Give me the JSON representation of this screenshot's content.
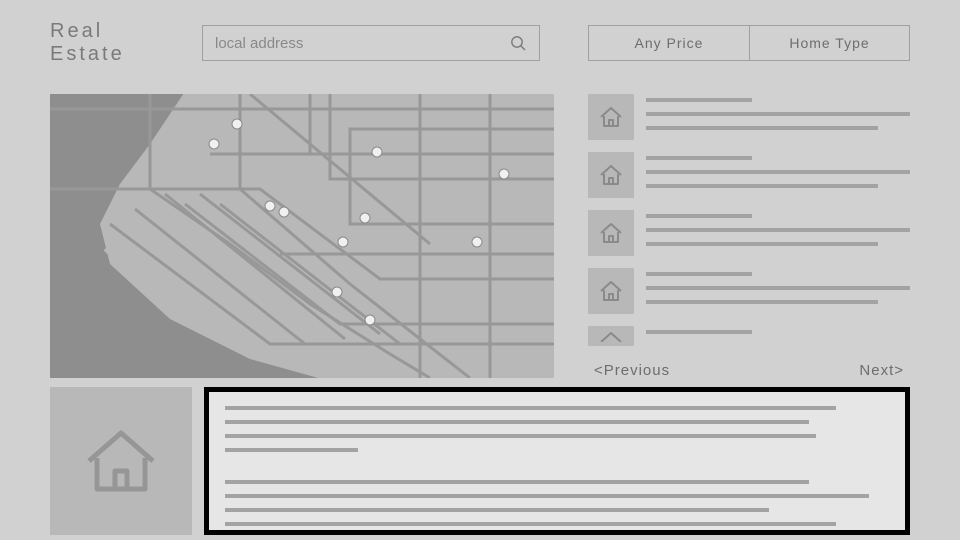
{
  "header": {
    "brand": "Real Estate",
    "search_placeholder": "local address",
    "filters": {
      "price": "Any Price",
      "type": "Home Type"
    }
  },
  "pager": {
    "prev": "<Previous",
    "next": "Next>"
  },
  "listings": [
    {
      "id": 1
    },
    {
      "id": 2
    },
    {
      "id": 3
    },
    {
      "id": 4
    },
    {
      "id": 5
    }
  ],
  "icons": {
    "house": "house-icon",
    "search": "search-icon"
  },
  "colors": {
    "bg": "#d1d1d1",
    "panel": "#b8b8b8",
    "line": "#a3a3a3",
    "text": "#6d6d6d",
    "border": "#a0a0a0",
    "focus": "#000000"
  }
}
